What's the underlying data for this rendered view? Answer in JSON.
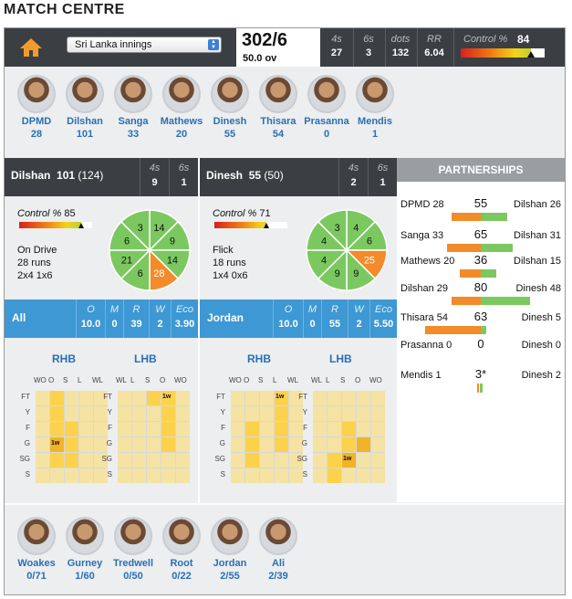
{
  "page_title": "MATCH CENTRE",
  "innings_select": "Sri Lanka innings",
  "score": "302/6",
  "overs": "50.0 ov",
  "stats": [
    {
      "label": "4s",
      "value": "27"
    },
    {
      "label": "6s",
      "value": "3"
    },
    {
      "label": "dots",
      "value": "132"
    },
    {
      "label": "RR",
      "value": "6.04"
    }
  ],
  "control": {
    "label": "Control %",
    "value": "84",
    "level": 0.84
  },
  "batsmen": [
    {
      "name": "DPMD",
      "score": "28"
    },
    {
      "name": "Dilshan",
      "score": "101"
    },
    {
      "name": "Sanga",
      "score": "33"
    },
    {
      "name": "Mathews",
      "score": "20"
    },
    {
      "name": "Dinesh",
      "score": "55"
    },
    {
      "name": "Thisara",
      "score": "54"
    },
    {
      "name": "Prasanna",
      "score": "0"
    },
    {
      "name": "Mendis",
      "score": "1"
    }
  ],
  "striker": {
    "name": "Dilshan",
    "runs": "101",
    "balls": "(124)",
    "fours_label": "4s",
    "fours": "9",
    "sixes_label": "6s",
    "sixes": "1",
    "control_label": "Control %",
    "control": "85",
    "control_level": 0.85,
    "shot": "On Drive",
    "shot_runs": "28 runs",
    "shot_detail": "2x4 1x6",
    "wheel": [
      "14",
      "9",
      "14",
      "28",
      "6",
      "21",
      "6",
      "3"
    ],
    "highlight": 3
  },
  "nonstriker": {
    "name": "Dinesh",
    "runs": "55",
    "balls": "(50)",
    "fours_label": "4s",
    "fours": "2",
    "sixes_label": "6s",
    "sixes": "1",
    "control_label": "Control %",
    "control": "71",
    "control_level": 0.71,
    "shot": "Flick",
    "shot_runs": "18 runs",
    "shot_detail": "1x4 0x6",
    "wheel": [
      "4",
      "6",
      "25",
      "9",
      "9",
      "4",
      "4",
      "3"
    ],
    "highlight": 2
  },
  "bowler_left": {
    "name": "All",
    "cols": [
      {
        "label": "O",
        "value": "10.0"
      },
      {
        "label": "M",
        "value": "0"
      },
      {
        "label": "R",
        "value": "39"
      },
      {
        "label": "W",
        "value": "2"
      },
      {
        "label": "Eco",
        "value": "3.90"
      }
    ]
  },
  "bowler_right": {
    "name": "Jordan",
    "cols": [
      {
        "label": "O",
        "value": "10.0"
      },
      {
        "label": "M",
        "value": "0"
      },
      {
        "label": "R",
        "value": "55"
      },
      {
        "label": "W",
        "value": "2"
      },
      {
        "label": "Eco",
        "value": "5.50"
      }
    ]
  },
  "pitch": {
    "rhb_label": "RHB",
    "lhb_label": "LHB",
    "rhb_cols": [
      "WO",
      "O",
      "S",
      "L",
      "WL"
    ],
    "lhb_cols": [
      "WL",
      "L",
      "S",
      "O",
      "WO"
    ],
    "rows": [
      "FT",
      "Y",
      "F",
      "G",
      "SG",
      "S"
    ],
    "wicket_mark": "1w",
    "grids": [
      {
        "cells": [
          "p",
          "y",
          "p",
          "p",
          "p",
          "p",
          "y",
          "p",
          "p",
          "p",
          "p",
          "y",
          "y",
          "p",
          "p",
          "p",
          "o",
          "y",
          "p",
          "p",
          "p",
          "y",
          "y",
          "p",
          "p",
          "p",
          "p",
          "p",
          "p",
          "p"
        ],
        "wicket_index": 16
      },
      {
        "cells": [
          "p",
          "p",
          "y",
          "y",
          "p",
          "p",
          "p",
          "p",
          "y",
          "p",
          "p",
          "p",
          "p",
          "y",
          "p",
          "p",
          "p",
          "p",
          "y",
          "p",
          "p",
          "p",
          "p",
          "p",
          "p",
          "p",
          "p",
          "p",
          "p",
          "p"
        ],
        "wicket_index": 3
      },
      {
        "cells": [
          "p",
          "p",
          "p",
          "y",
          "p",
          "p",
          "p",
          "p",
          "y",
          "p",
          "p",
          "y",
          "p",
          "y",
          "p",
          "p",
          "y",
          "p",
          "y",
          "p",
          "p",
          "y",
          "p",
          "p",
          "p",
          "p",
          "p",
          "p",
          "p",
          "p"
        ],
        "wicket_index": 3
      },
      {
        "cells": [
          "p",
          "p",
          "p",
          "p",
          "p",
          "p",
          "p",
          "p",
          "p",
          "p",
          "p",
          "p",
          "y",
          "p",
          "p",
          "p",
          "p",
          "y",
          "o",
          "p",
          "p",
          "y",
          "o",
          "p",
          "p",
          "p",
          "y",
          "p",
          "p",
          "p"
        ],
        "wicket_index": 22
      }
    ]
  },
  "partnerships": {
    "title": "PARTNERSHIPS",
    "items": [
      {
        "left": "DPMD 28",
        "total": "55",
        "right": "Dilshan 26",
        "lfrac": 0.51,
        "rfrac": 0.47
      },
      {
        "left": "Sanga 33",
        "total": "65",
        "right": "Dilshan 31",
        "lfrac": 0.51,
        "rfrac": 0.48
      },
      {
        "left": "Mathews 20",
        "total": "36",
        "right": "Dilshan 15",
        "lfrac": 0.56,
        "rfrac": 0.42
      },
      {
        "left": "Dilshan 29",
        "total": "80",
        "right": "Dinesh 48",
        "lfrac": 0.36,
        "rfrac": 0.6
      },
      {
        "left": "Thisara 54",
        "total": "63",
        "right": "Dinesh 5",
        "lfrac": 0.86,
        "rfrac": 0.08
      },
      {
        "left": "Prasanna 0",
        "total": "0",
        "right": "Dinesh 0",
        "lfrac": 0,
        "rfrac": 0
      },
      {
        "left": "Mendis 1",
        "total": "3*",
        "right": "Dinesh 2",
        "lfrac": 0.33,
        "rfrac": 0.67
      }
    ]
  },
  "bowlers": [
    {
      "name": "Woakes",
      "figures": "0/71"
    },
    {
      "name": "Gurney",
      "figures": "1/60"
    },
    {
      "name": "Tredwell",
      "figures": "0/50"
    },
    {
      "name": "Root",
      "figures": "0/22"
    },
    {
      "name": "Jordan",
      "figures": "2/55"
    },
    {
      "name": "Ali",
      "figures": "2/39"
    }
  ],
  "colors": {
    "bar_dark": "#3b3f43",
    "bowler_blue": "#3d98d4",
    "link_blue": "#2a6fb4",
    "wheel_green": "#7cc860",
    "wheel_orange": "#f28b2a"
  }
}
